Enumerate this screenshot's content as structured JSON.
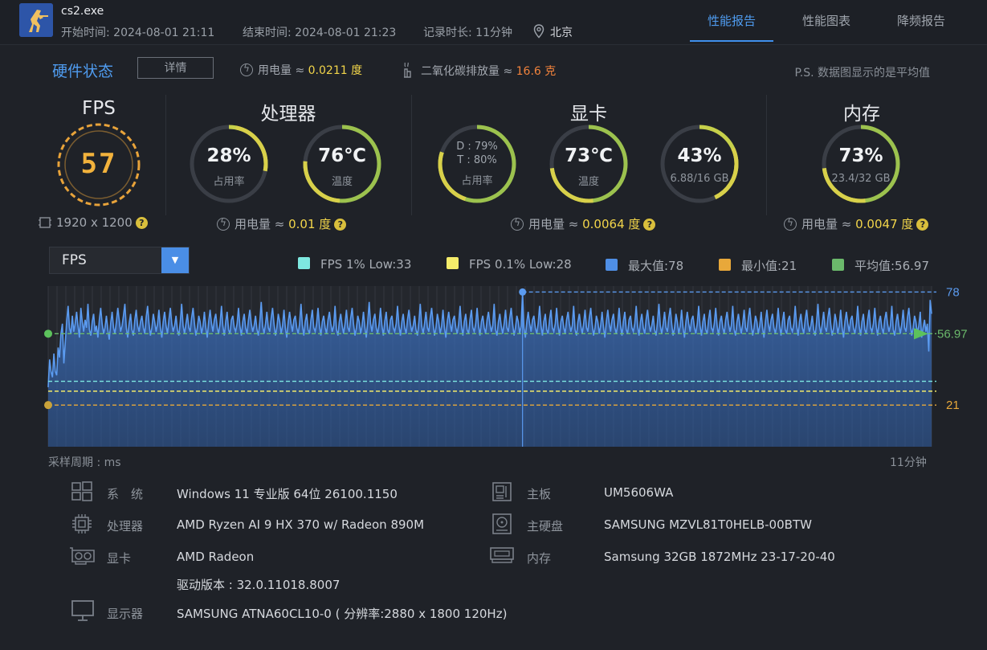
{
  "header": {
    "app_name": "cs2.exe",
    "start_time_label": "开始时间: 2024-08-01 21:11",
    "end_time_label": "结束时间: 2024-08-01 21:23",
    "duration_label": "记录时长: 11分钟",
    "location": "北京",
    "tabs": [
      "性能报告",
      "性能图表",
      "降频报告"
    ],
    "active_tab": 0
  },
  "hardware": {
    "title": "硬件状态",
    "detail_button": "详情",
    "power_label": "用电量 ≈",
    "power_value": "0.0211 度",
    "co2_label": "二氧化碳排放量 ≈",
    "co2_value": "16.6 克",
    "note": "P.S. 数据图显示的是平均值"
  },
  "fps": {
    "title": "FPS",
    "value": "57",
    "resolution": "1920 x 1200"
  },
  "cpu": {
    "title": "处理器",
    "usage": {
      "value": "28%",
      "label": "占用率",
      "percent": 28
    },
    "temp": {
      "value": "76℃",
      "label": "温度",
      "percent": 76
    },
    "power_label": "用电量 ≈",
    "power_value": "0.01 度"
  },
  "gpu": {
    "title": "显卡",
    "usage": {
      "line1": "D : 79%",
      "line2": "T : 80%",
      "label": "占用率",
      "percent": 80
    },
    "temp": {
      "value": "73℃",
      "label": "温度",
      "percent": 73
    },
    "vram": {
      "value": "43%",
      "label": "6.88/16 GB",
      "percent": 43
    },
    "power_label": "用电量 ≈",
    "power_value": "0.0064 度"
  },
  "memory": {
    "title": "内存",
    "usage": {
      "value": "73%",
      "label": "23.4/32 GB",
      "percent": 73
    },
    "power_label": "用电量 ≈",
    "power_value": "0.0047 度"
  },
  "chart_controls": {
    "selected_metric": "FPS"
  },
  "legend": [
    {
      "label": "FPS 1% Low:33",
      "color": "#7ee8e0"
    },
    {
      "label": "FPS 0.1% Low:28",
      "color": "#f4ec6a"
    },
    {
      "label": "最大值:78",
      "color": "#4f8fe6"
    },
    {
      "label": "最小值:21",
      "color": "#e8a83a"
    },
    {
      "label": "平均值:56.97",
      "color": "#6bb96b"
    }
  ],
  "chart_data": {
    "type": "area",
    "series": [
      {
        "name": "FPS"
      }
    ],
    "x_start_label": "采样周期 : ms",
    "x_end_label": "11分钟",
    "ylim": [
      0,
      81
    ],
    "max": 78,
    "min": 21,
    "avg": 56.97,
    "low_1pct": 33,
    "low_01pct": 28,
    "max_label": "78",
    "min_label": "21",
    "avg_label": "56.97",
    "values": [
      30,
      44,
      38,
      35,
      47,
      38,
      36,
      50,
      45,
      57,
      62,
      42,
      52,
      63,
      71,
      60,
      57,
      66,
      58,
      62,
      68,
      61,
      55,
      70,
      63,
      58,
      64,
      60,
      72,
      59,
      56,
      63,
      67,
      58,
      61,
      55,
      64,
      70,
      62,
      57,
      60,
      66,
      59,
      54,
      62,
      68,
      60,
      57,
      63,
      70,
      64,
      58,
      61,
      66,
      72,
      60,
      55,
      62,
      67,
      59,
      56,
      64,
      69,
      61,
      58,
      63,
      66,
      60,
      57,
      65,
      71,
      62,
      56,
      60,
      67,
      63,
      58,
      62,
      69,
      60,
      55,
      63,
      68,
      61,
      57,
      64,
      70,
      62,
      58,
      61,
      66,
      59,
      56,
      63,
      72,
      61,
      57,
      62,
      67,
      60,
      58,
      65,
      70,
      62,
      56,
      60,
      66,
      63,
      57,
      61,
      68,
      60,
      55,
      63,
      69,
      62,
      58,
      64,
      67,
      60,
      57,
      62,
      71,
      61,
      56,
      63,
      68,
      59,
      57,
      64,
      66,
      60,
      58,
      62,
      70,
      61,
      56,
      63,
      67,
      60,
      57,
      64,
      69,
      62,
      58,
      61,
      66,
      59,
      56,
      63,
      73,
      61,
      57,
      62,
      68,
      60,
      58,
      65,
      70,
      62,
      56,
      60,
      67,
      63,
      57,
      61,
      69,
      60,
      55,
      63,
      68,
      62,
      58,
      64,
      66,
      60,
      57,
      62,
      72,
      61,
      56,
      63,
      67,
      59,
      57,
      64,
      69,
      60,
      58,
      62,
      70,
      61,
      56,
      63,
      66,
      60,
      57,
      64,
      68,
      62,
      58,
      61,
      71,
      59,
      56,
      63,
      67,
      61,
      57,
      62,
      69,
      60,
      58,
      65,
      70,
      62,
      56,
      60,
      66,
      63,
      57,
      61,
      68,
      60,
      55,
      63,
      73,
      62,
      58,
      64,
      67,
      60,
      57,
      62,
      70,
      61,
      56,
      63,
      68,
      59,
      57,
      64,
      66,
      60,
      58,
      62,
      71,
      61,
      56,
      63,
      67,
      60,
      57,
      64,
      69,
      62,
      58,
      61,
      66,
      59,
      56,
      63,
      72,
      61,
      57,
      62,
      68,
      60,
      58,
      65,
      70,
      62,
      56,
      60,
      67,
      63,
      57,
      61,
      69,
      60,
      55,
      63,
      68,
      62,
      58,
      64,
      66,
      60,
      57,
      62,
      71,
      61,
      56,
      63,
      67,
      59,
      57,
      64,
      69,
      60,
      58,
      62,
      70,
      61,
      56,
      63,
      66,
      60,
      57,
      64,
      68,
      62,
      58,
      61,
      72,
      59,
      56,
      63,
      67,
      61,
      57,
      62,
      69,
      60,
      58,
      65,
      70,
      62,
      56,
      60,
      66,
      63,
      57,
      61,
      78,
      60,
      55,
      63,
      68,
      62,
      58,
      64,
      66,
      60,
      57,
      62,
      71,
      61,
      56,
      63,
      67,
      59,
      57,
      64,
      69,
      60,
      58,
      62,
      70,
      61,
      56,
      63,
      66,
      60,
      57,
      64,
      68,
      62,
      58,
      61,
      71,
      59,
      56,
      63,
      67,
      61,
      57,
      62,
      69,
      60,
      58,
      65,
      70,
      62,
      56,
      60,
      66,
      63,
      57,
      61,
      68,
      60,
      55,
      63,
      69,
      62,
      58,
      64,
      67,
      60,
      57,
      62,
      70,
      61,
      56,
      63,
      68,
      59,
      57,
      64,
      66,
      60,
      58,
      62,
      71,
      61,
      56,
      63,
      67,
      60,
      57,
      64,
      69,
      62,
      58,
      61,
      66,
      59,
      56,
      63,
      72,
      61,
      57,
      62,
      68,
      60,
      58,
      65,
      70,
      62,
      56,
      60,
      67,
      63,
      57,
      61,
      69,
      60,
      55,
      63,
      68,
      62,
      58,
      64,
      66,
      60,
      57,
      62,
      71,
      61,
      56,
      63,
      67,
      59,
      57,
      64,
      69,
      60,
      58,
      62,
      70,
      61,
      56,
      63,
      66,
      60,
      57,
      64,
      68,
      62,
      58,
      61,
      71,
      59,
      56,
      63,
      67,
      61,
      57,
      62,
      69,
      60,
      58,
      65,
      70,
      62,
      56,
      60,
      66,
      63,
      57,
      61,
      68,
      60,
      55,
      63,
      69,
      62,
      58,
      64,
      67,
      60,
      57,
      62,
      70,
      61,
      56,
      63,
      68,
      59,
      57,
      64,
      66,
      60,
      58,
      62,
      71,
      61,
      56,
      63,
      67,
      60,
      57,
      64,
      69,
      62,
      58,
      61,
      66,
      59,
      56,
      63,
      72,
      61,
      57,
      62,
      68,
      60,
      58,
      65,
      70,
      62,
      56,
      60,
      67,
      63,
      57,
      61,
      69,
      60,
      55,
      63,
      68,
      62,
      58,
      64,
      66,
      60,
      57,
      62,
      71,
      61,
      56,
      63,
      67,
      59,
      57,
      64,
      69,
      60,
      58,
      62,
      70,
      61,
      56,
      63,
      66,
      60,
      57,
      64,
      68,
      62,
      58,
      61,
      71,
      59,
      56,
      63,
      67,
      61,
      57,
      62,
      69,
      60,
      58,
      65,
      70,
      62,
      56,
      60,
      66,
      63,
      57,
      61,
      68,
      55,
      60,
      64,
      58,
      62,
      48,
      74,
      67
    ]
  },
  "system_info": [
    {
      "label": "系　统",
      "value": "Windows 11 专业版 64位 26100.1150",
      "icon": "windows-icon"
    },
    {
      "label": "处理器",
      "value": "AMD Ryzen AI 9 HX 370 w/ Radeon 890M",
      "icon": "cpu-icon"
    },
    {
      "label": "显卡",
      "value": "AMD Radeon",
      "icon": "gpu-icon"
    },
    {
      "label": "",
      "value": "驱动版本 : 32.0.11018.8007",
      "icon": ""
    },
    {
      "label": "显示器",
      "value": "SAMSUNG ATNA60CL10-0 ( 分辨率:2880 x 1800 120Hz)",
      "icon": "monitor-icon"
    },
    {
      "label": "主板",
      "value": "UM5606WA",
      "icon": "motherboard-icon"
    },
    {
      "label": "主硬盘",
      "value": "SAMSUNG MZVL81T0HELB-00BTW",
      "icon": "disk-icon"
    },
    {
      "label": "内存",
      "value": "Samsung 32GB 1872MHz 23-17-20-40",
      "icon": "memory-icon"
    }
  ]
}
